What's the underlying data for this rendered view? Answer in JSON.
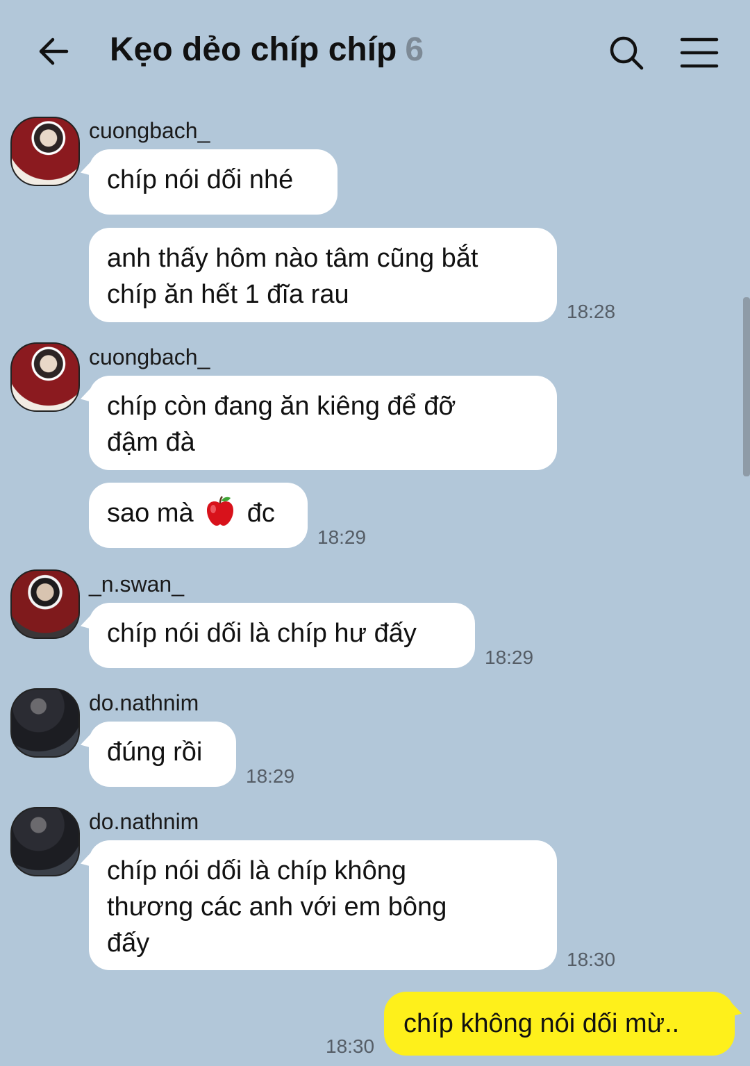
{
  "header": {
    "title": "Kẹo dẻo chíp chíp",
    "member_count": "6"
  },
  "messages": [
    {
      "sender": "cuongbach_",
      "bubbles": [
        "chíp nói dối nhé",
        "anh thấy hôm nào tâm cũng bắt",
        "chíp ăn hết 1 đĩa rau"
      ],
      "time": "18:28"
    },
    {
      "sender": "cuongbach_",
      "bubbles": [
        "chíp còn đang ăn kiêng để đỡ",
        "đậm đà",
        "sao mà",
        "đc"
      ],
      "time": "18:29"
    },
    {
      "sender": "_n.swan_",
      "bubbles": [
        "chíp nói dối là chíp hư đấy"
      ],
      "time": "18:29"
    },
    {
      "sender": "do.nathnim",
      "bubbles": [
        "đúng rồi"
      ],
      "time": "18:29"
    },
    {
      "sender": "do.nathnim",
      "bubbles": [
        "chíp nói dối là chíp không",
        "thương các anh với em bông",
        "đấy"
      ],
      "time": "18:30"
    },
    {
      "sender": "me",
      "bubbles": [
        "chíp không nói dối mừ.."
      ],
      "time": "18:30"
    }
  ],
  "icons": {
    "back": "arrow-left-icon",
    "search": "search-icon",
    "menu": "hamburger-menu-icon",
    "emoji": "red-apple-emoji"
  },
  "colors": {
    "background": "#b2c7d9",
    "incoming_bubble": "#ffffff",
    "outgoing_bubble": "#fef01b",
    "member_count": "#7d8a96"
  }
}
